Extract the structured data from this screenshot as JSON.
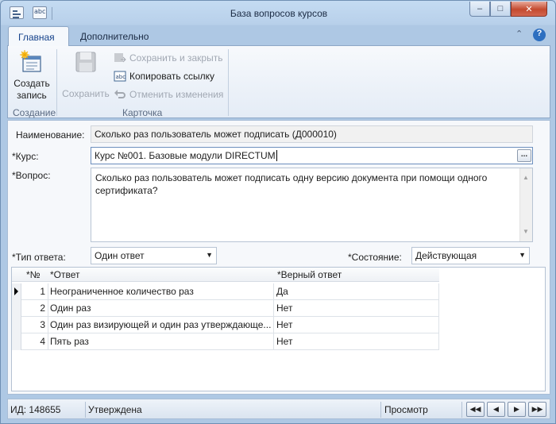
{
  "window": {
    "title": "База вопросов курсов"
  },
  "ribbon": {
    "tabs": [
      {
        "label": "Главная"
      },
      {
        "label": "Дополнительно"
      }
    ],
    "create": {
      "label_line1": "Создать",
      "label_line2": "запись",
      "group": "Создание"
    },
    "save": {
      "label": "Сохранить"
    },
    "save_close": {
      "label": "Сохранить и закрыть"
    },
    "copy_link": {
      "label": "Копировать ссылку"
    },
    "undo": {
      "label": "Отменить изменения"
    },
    "card_group": "Карточка"
  },
  "form": {
    "name": {
      "label": "Наименование:",
      "value": "Сколько раз пользователь может подписать (Д000010)"
    },
    "course": {
      "label": "*Курс:",
      "value": "Курс №001. Базовые модули DIRECTUM",
      "button": "..."
    },
    "question": {
      "label": "*Вопрос:",
      "value": "Сколько раз пользователь может подписать одну версию документа при помощи одного сертификата?"
    },
    "answer_type": {
      "label": "*Тип ответа:",
      "value": "Один ответ"
    },
    "state": {
      "label": "*Состояние:",
      "value": "Действующая"
    }
  },
  "grid": {
    "columns": {
      "num": "*№",
      "answer": "*Ответ",
      "correct": "*Верный ответ"
    },
    "rows": [
      {
        "num": "1",
        "answer": "Неограниченное количество раз",
        "correct": "Да"
      },
      {
        "num": "2",
        "answer": "Один раз",
        "correct": "Нет"
      },
      {
        "num": "3",
        "answer": "Один раз визирующей и один раз утверждающе...",
        "correct": "Нет"
      },
      {
        "num": "4",
        "answer": "Пять раз",
        "correct": "Нет"
      }
    ]
  },
  "status": {
    "id": "ИД: 148655",
    "state": "Утверждена",
    "mode": "Просмотр"
  },
  "colors": {
    "accent": "#15428b",
    "frame": "#aec8e4"
  }
}
